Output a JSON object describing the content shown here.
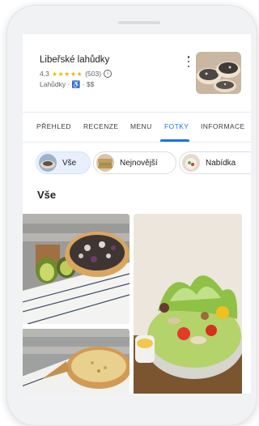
{
  "place": {
    "name": "Libeřské lahůdky",
    "rating": "4,3",
    "stars": "★★★★★",
    "review_count": "(503)",
    "category": "Lahůdky",
    "separator": "·",
    "price": "$$",
    "star_color": "#f4b400"
  },
  "tabs": [
    {
      "label": "PŘEHLED",
      "active": false
    },
    {
      "label": "RECENZE",
      "active": false
    },
    {
      "label": "MENU",
      "active": false
    },
    {
      "label": "FOTKY",
      "active": true
    },
    {
      "label": "INFORMACE",
      "active": false
    }
  ],
  "chips": [
    {
      "label": "Vše",
      "active": true
    },
    {
      "label": "Nejnovější",
      "active": false
    },
    {
      "label": "Nabídka",
      "active": false
    }
  ],
  "section_title": "Vše",
  "colors": {
    "accent": "#1a73e8",
    "chip_active_bg": "#e8f0fe"
  },
  "icons": [
    "more-vert-icon",
    "info-icon",
    "wheelchair-icon"
  ]
}
